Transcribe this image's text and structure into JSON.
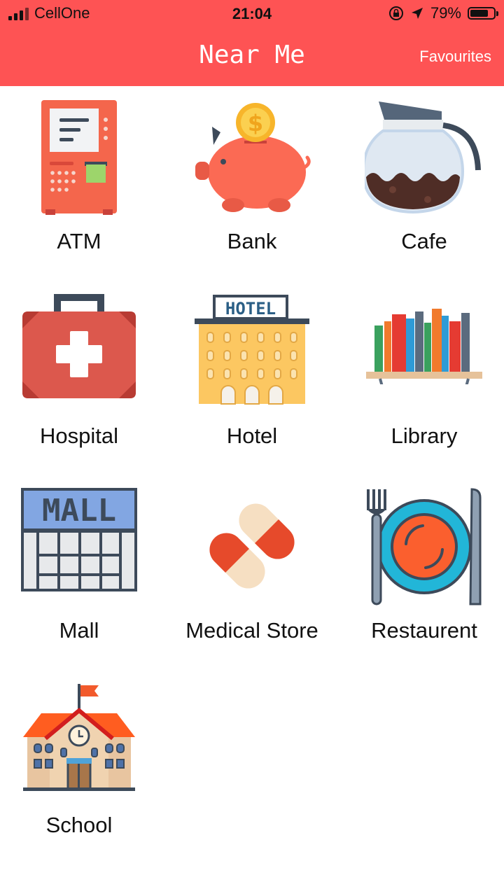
{
  "status_bar": {
    "carrier": "CellOne",
    "time": "21:04",
    "battery": "79%",
    "battery_level": 0.79
  },
  "header": {
    "title": "Near Me",
    "favourites_label": "Favourites"
  },
  "categories": [
    {
      "label": "ATM",
      "icon": "atm-icon"
    },
    {
      "label": "Bank",
      "icon": "piggy-bank-icon"
    },
    {
      "label": "Cafe",
      "icon": "coffee-pot-icon"
    },
    {
      "label": "Hospital",
      "icon": "first-aid-kit-icon"
    },
    {
      "label": "Hotel",
      "icon": "hotel-building-icon"
    },
    {
      "label": "Library",
      "icon": "bookshelf-icon"
    },
    {
      "label": "Mall",
      "icon": "mall-building-icon"
    },
    {
      "label": "Medical Store",
      "icon": "pills-icon"
    },
    {
      "label": "Restaurent",
      "icon": "plate-fork-knife-icon"
    },
    {
      "label": "School",
      "icon": "school-building-icon"
    }
  ],
  "colors": {
    "header": "#fe5354",
    "text": "#111111"
  }
}
